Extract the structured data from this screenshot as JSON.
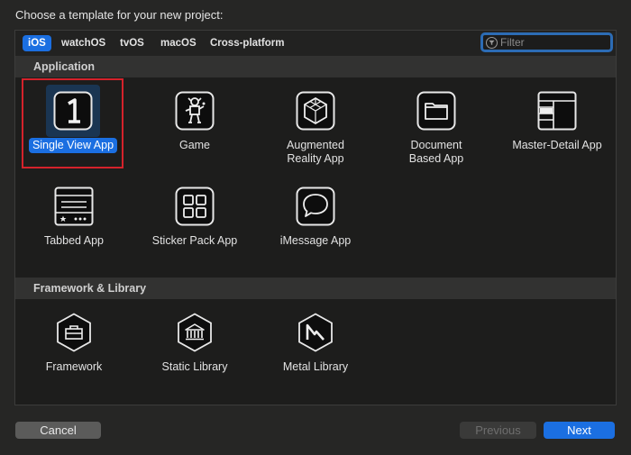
{
  "window": {
    "title": "Choose a template for your new project:"
  },
  "platform_tabs": [
    {
      "label": "iOS",
      "active": true
    },
    {
      "label": "watchOS",
      "active": false
    },
    {
      "label": "tvOS",
      "active": false
    },
    {
      "label": "macOS",
      "active": false
    },
    {
      "label": "Cross-platform",
      "active": false
    }
  ],
  "filter": {
    "placeholder": "Filter",
    "value": ""
  },
  "sections": {
    "application": {
      "title": "Application",
      "templates": [
        {
          "label": "Single View App",
          "icon": "single-view-icon",
          "selected": true
        },
        {
          "label": "Game",
          "icon": "game-icon"
        },
        {
          "label": "Augmented\nReality App",
          "icon": "ar-cube-icon"
        },
        {
          "label": "Document\nBased App",
          "icon": "folder-icon"
        },
        {
          "label": "Master-Detail App",
          "icon": "master-detail-icon"
        },
        {
          "label": "Tabbed App",
          "icon": "tabbed-app-icon"
        },
        {
          "label": "Sticker Pack App",
          "icon": "sticker-grid-icon"
        },
        {
          "label": "iMessage App",
          "icon": "message-bubble-icon"
        }
      ]
    },
    "framework": {
      "title": "Framework & Library",
      "templates": [
        {
          "label": "Framework",
          "icon": "toolbox-icon"
        },
        {
          "label": "Static Library",
          "icon": "library-building-icon"
        },
        {
          "label": "Metal Library",
          "icon": "metal-icon"
        }
      ]
    }
  },
  "buttons": {
    "cancel": "Cancel",
    "previous": "Previous",
    "next": "Next"
  },
  "colors": {
    "accent": "#1b6fe1",
    "selection_frame": "#d5222b",
    "background": "#262625"
  }
}
